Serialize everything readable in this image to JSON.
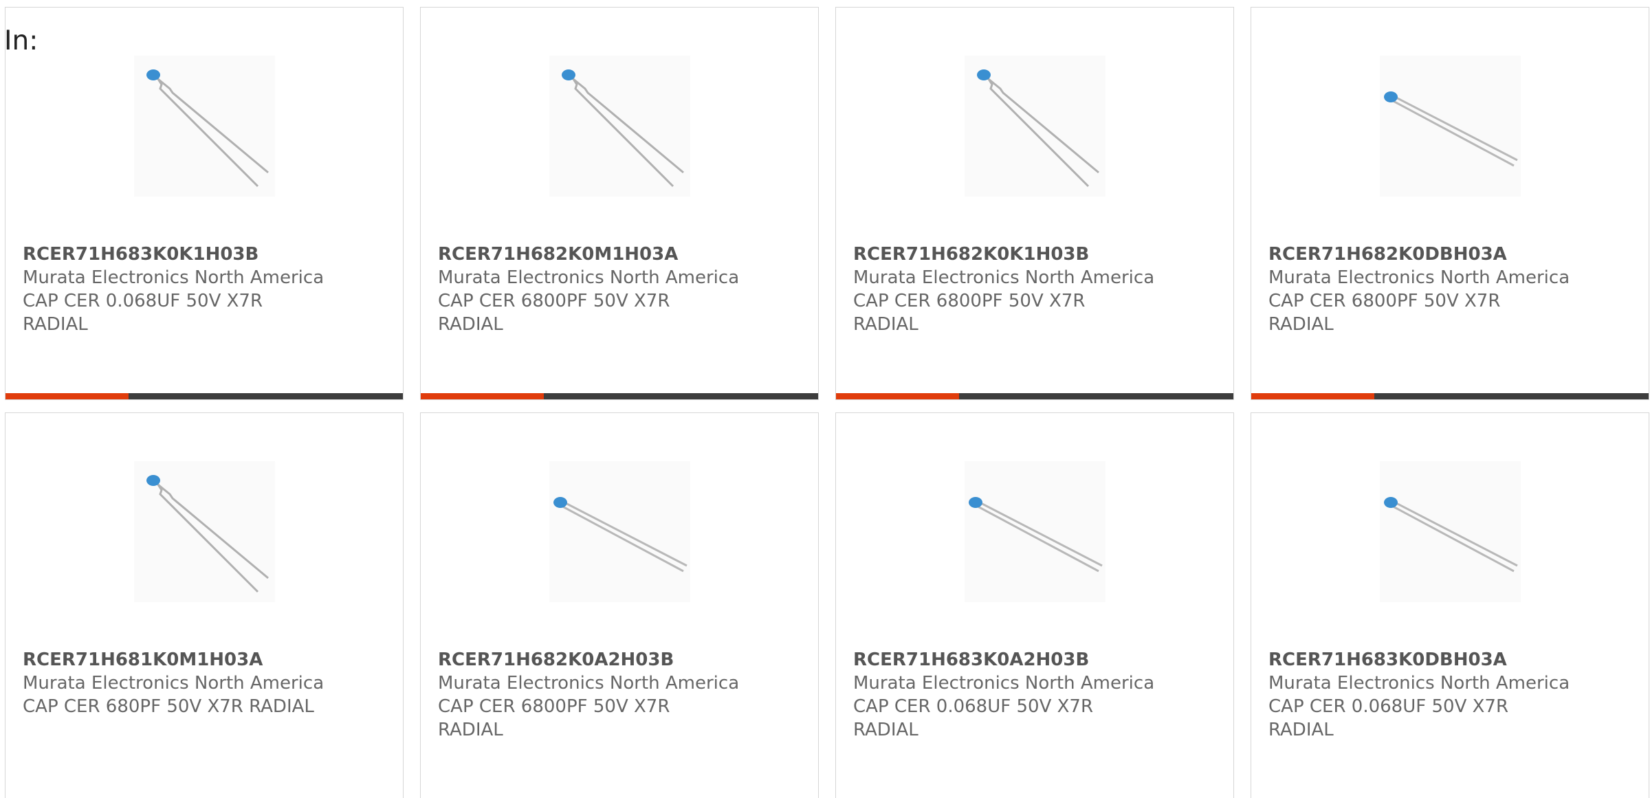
{
  "header": {
    "label": "In:"
  },
  "colors": {
    "accent": "#e03c0c",
    "bar_track": "#3d3d3d",
    "capacitor_body": "#3a8fd1"
  },
  "products": [
    {
      "part": "RCER71H683K0K1H03B",
      "manufacturer": "Murata Electronics North America",
      "description": "CAP CER 0.068UF 50V X7R RADIAL",
      "image": "capacitor-kinked-leads-icon",
      "progress": 0.31
    },
    {
      "part": "RCER71H682K0M1H03A",
      "manufacturer": "Murata Electronics North America",
      "description": "CAP CER 6800PF 50V X7R RADIAL",
      "image": "capacitor-kinked-leads-icon",
      "progress": 0.31
    },
    {
      "part": "RCER71H682K0K1H03B",
      "manufacturer": "Murata Electronics North America",
      "description": "CAP CER 6800PF 50V X7R RADIAL",
      "image": "capacitor-kinked-leads-icon",
      "progress": 0.31
    },
    {
      "part": "RCER71H682K0DBH03A",
      "manufacturer": "Murata Electronics North America",
      "description": "CAP CER 6800PF 50V X7R RADIAL",
      "image": "capacitor-straight-leads-icon",
      "progress": 0.31
    },
    {
      "part": "RCER71H681K0M1H03A",
      "manufacturer": "Murata Electronics North America",
      "description": "CAP CER 680PF 50V X7R RADIAL",
      "image": "capacitor-kinked-leads-icon"
    },
    {
      "part": "RCER71H682K0A2H03B",
      "manufacturer": "Murata Electronics North America",
      "description": "CAP CER 6800PF 50V X7R RADIAL",
      "image": "capacitor-straight-leads-icon"
    },
    {
      "part": "RCER71H683K0A2H03B",
      "manufacturer": "Murata Electronics North America",
      "description": "CAP CER 0.068UF 50V X7R RADIAL",
      "image": "capacitor-straight-leads-icon"
    },
    {
      "part": "RCER71H683K0DBH03A",
      "manufacturer": "Murata Electronics North America",
      "description": "CAP CER 0.068UF 50V X7R RADIAL",
      "image": "capacitor-straight-leads-icon"
    }
  ]
}
